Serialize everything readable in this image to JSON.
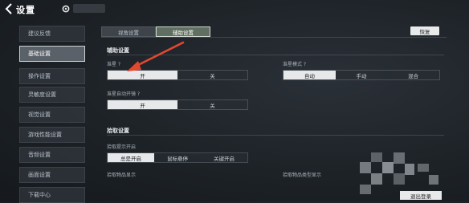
{
  "header": {
    "title": "设置",
    "back_icon": "chevron-left-icon",
    "settings_icon": "gear-icon"
  },
  "sidebar": {
    "items": [
      {
        "label": "建议反馈",
        "active": false
      },
      {
        "label": "基础设置",
        "active": true
      },
      {
        "label": "操作设置",
        "active": false
      },
      {
        "label": "灵敏度设置",
        "active": false
      },
      {
        "label": "视觉设置",
        "active": false
      },
      {
        "label": "游戏性能设置",
        "active": false
      },
      {
        "label": "音频设置",
        "active": false
      },
      {
        "label": "画面设置",
        "active": false
      },
      {
        "label": "下载中心",
        "active": false
      }
    ]
  },
  "tabs": [
    {
      "label": "视角设置",
      "active": false
    },
    {
      "label": "辅助设置",
      "active": true
    }
  ],
  "restore_button": "恢复",
  "section1": {
    "title": "辅助设置",
    "row1_left": {
      "label": "准星 ?",
      "options": [
        "开",
        "关"
      ],
      "selected": 0
    },
    "row1_right": {
      "label": "准星模式 ?",
      "options": [
        "自动",
        "手动",
        "混合"
      ],
      "selected": 0
    },
    "row2_left": {
      "label": "准星自动开镜 ?",
      "options": [
        "开",
        "关"
      ],
      "selected": 0
    }
  },
  "section2": {
    "title": "拾取设置",
    "row1": {
      "label": "拾取提示开启",
      "options": [
        "总是开启",
        "鼠标悬停",
        "关键开启"
      ],
      "selected": 0
    },
    "row2_left_label": "拾取物品显示",
    "row2_right_label": "拾取物品类型显示"
  },
  "logout_button": "退出登录",
  "colors": {
    "accent_arrow": "#e4472f",
    "selected": "#e6e8ea"
  }
}
